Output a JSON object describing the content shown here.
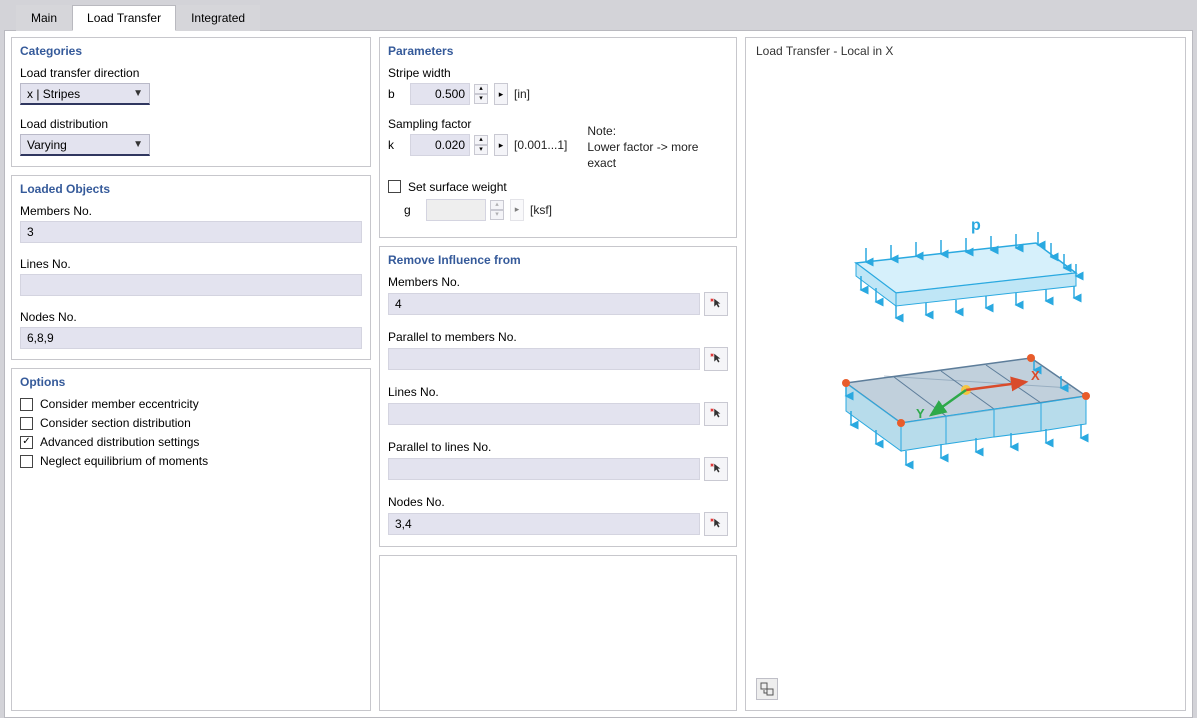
{
  "tabs": {
    "main": "Main",
    "load_transfer": "Load Transfer",
    "integrated": "Integrated"
  },
  "categories": {
    "title": "Categories",
    "direction_label": "Load transfer direction",
    "direction_value": "x | Stripes",
    "distribution_label": "Load distribution",
    "distribution_value": "Varying"
  },
  "loaded_objects": {
    "title": "Loaded Objects",
    "members_label": "Members No.",
    "members_value": "3",
    "lines_label": "Lines No.",
    "lines_value": "",
    "nodes_label": "Nodes No.",
    "nodes_value": "6,8,9"
  },
  "options": {
    "title": "Options",
    "eccentricity": "Consider member eccentricity",
    "section_dist": "Consider section distribution",
    "advanced": "Advanced distribution settings",
    "neglect": "Neglect equilibrium of moments"
  },
  "parameters": {
    "title": "Parameters",
    "stripe_label": "Stripe width",
    "stripe_sym": "b",
    "stripe_value": "0.500",
    "stripe_unit": "[in]",
    "sampling_label": "Sampling factor",
    "sampling_sym": "k",
    "sampling_value": "0.020",
    "sampling_unit": "[0.001...1]",
    "note_title": "Note:",
    "note_body": "Lower factor ->  more exact",
    "surface_weight": "Set surface weight",
    "g_sym": "g",
    "g_value": "",
    "g_unit": "[ksf]"
  },
  "remove": {
    "title": "Remove Influence from",
    "members_label": "Members No.",
    "members_value": "4",
    "parallel_members_label": "Parallel to members No.",
    "parallel_members_value": "",
    "lines_label": "Lines No.",
    "lines_value": "",
    "parallel_lines_label": "Parallel to lines No.",
    "parallel_lines_value": "",
    "nodes_label": "Nodes No.",
    "nodes_value": "3,4"
  },
  "preview": {
    "title": "Load Transfer - Local in X",
    "p_label": "p",
    "x_label": "X",
    "y_label": "Y"
  }
}
